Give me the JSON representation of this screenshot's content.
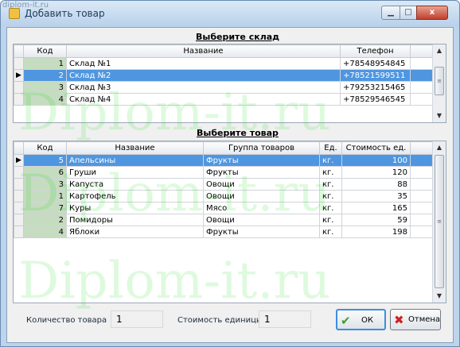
{
  "window": {
    "title": "Добавить товар",
    "site_watermark": "diplom-it.ru",
    "watermark_text": "Diplom-it.ru",
    "minimize_glyph": "▁",
    "maximize_glyph": "□",
    "close_glyph": "x"
  },
  "warehouses": {
    "title": "Выберите склад",
    "columns": [
      "Код",
      "Название",
      "Телефон"
    ],
    "selected_index": 1,
    "rows": [
      {
        "code": "1",
        "name": "Склад №1",
        "phone": "+78548954845"
      },
      {
        "code": "2",
        "name": "Склад №2",
        "phone": "+78521599511"
      },
      {
        "code": "3",
        "name": "Склад №3",
        "phone": "+79253215465"
      },
      {
        "code": "4",
        "name": "Склад №4",
        "phone": "+78529546545"
      }
    ]
  },
  "products": {
    "title": "Выберите товар",
    "columns": [
      "Код",
      "Название",
      "Группа товаров",
      "Ед.",
      "Стоимость ед."
    ],
    "selected_index": 0,
    "rows": [
      {
        "code": "5",
        "name": "Апельсины",
        "group": "Фрукты",
        "unit": "кг.",
        "price": "100"
      },
      {
        "code": "6",
        "name": "Груши",
        "group": "Фрукты",
        "unit": "кг.",
        "price": "120"
      },
      {
        "code": "3",
        "name": "Капуста",
        "group": "Овощи",
        "unit": "кг.",
        "price": "88"
      },
      {
        "code": "1",
        "name": "Картофель",
        "group": "Овощи",
        "unit": "кг.",
        "price": "35"
      },
      {
        "code": "7",
        "name": "Куры",
        "group": "Мясо",
        "unit": "кг.",
        "price": "165"
      },
      {
        "code": "2",
        "name": "Помидоры",
        "group": "Овощи",
        "unit": "кг.",
        "price": "59"
      },
      {
        "code": "4",
        "name": "Яблоки",
        "group": "Фрукты",
        "unit": "кг.",
        "price": "198"
      }
    ]
  },
  "footer": {
    "quantity_label": "Количество товара",
    "quantity_value": "1",
    "unit_price_label": "Стоимость единицы",
    "unit_price_value": "1",
    "ok_label": "ОК",
    "cancel_label": "Отмена"
  },
  "colors": {
    "selection": "#4f96e0",
    "code_cell": "#c6dcc0",
    "ok_icon": "#3aa030",
    "cancel_icon": "#d02020"
  },
  "icons": {
    "row_indicator": "triangle-right-icon",
    "ok": "check-icon",
    "cancel": "red-x-icon"
  }
}
